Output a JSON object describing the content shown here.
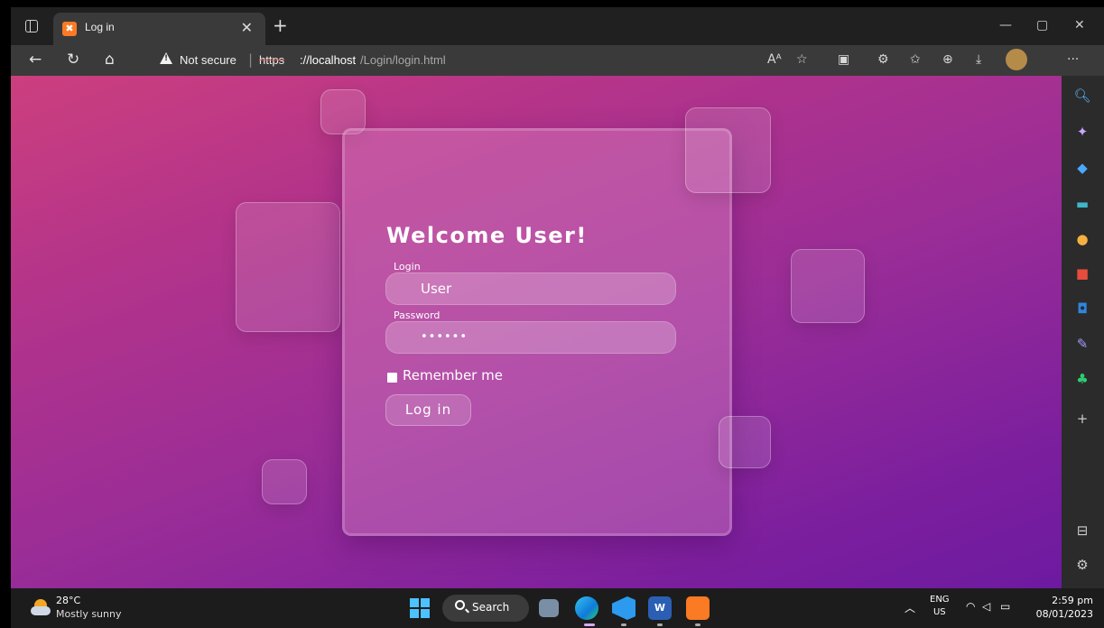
{
  "browser": {
    "tab_title": "Log in",
    "tab_favicon_text": "✖",
    "address": {
      "security_text": "Not secure",
      "url_scheme": "https",
      "url_host": "://localhost",
      "url_path": "/Login/login.html"
    }
  },
  "login_form": {
    "title": "Welcome User!",
    "login_label": "Login",
    "login_value": "User",
    "password_label": "Password",
    "password_value": "••••••",
    "remember_label": "Remember me",
    "remember_checked": true,
    "submit_label": "Log in"
  },
  "taskbar": {
    "weather_temp": "28°C",
    "weather_condition": "Mostly sunny",
    "search_label": "Search",
    "language_line1": "ENG",
    "language_line2": "US",
    "time": "2:59 pm",
    "date": "08/01/2023"
  },
  "colors": {
    "gradient_start": "#cc3f7e",
    "gradient_end": "#6d1aa0",
    "edge_accent": "#0078d4",
    "windows_blue": "#4cc2ff",
    "xampp_orange": "#fb7a24"
  }
}
